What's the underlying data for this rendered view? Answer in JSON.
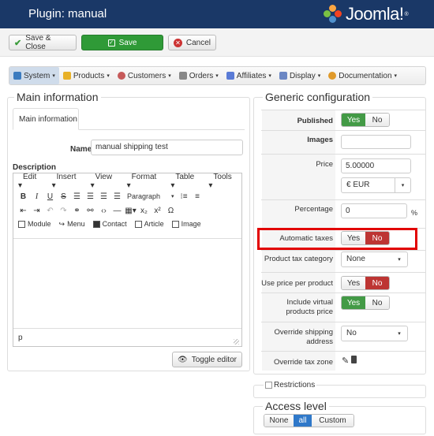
{
  "header": {
    "title": "Plugin: manual",
    "brand": "Joomla!",
    "brand_mark": "®"
  },
  "toolbar": {
    "save_close": "Save & Close",
    "save": "Save",
    "cancel": "Cancel"
  },
  "menu": {
    "items": [
      {
        "label": "System",
        "icon": "wrench-icon",
        "color": "#3b7bbf"
      },
      {
        "label": "Products",
        "icon": "box-icon",
        "color": "#e8b128"
      },
      {
        "label": "Customers",
        "icon": "users-icon",
        "color": "#c65a5a"
      },
      {
        "label": "Orders",
        "icon": "cart-icon",
        "color": "#888888"
      },
      {
        "label": "Affiliates",
        "icon": "chart-icon",
        "color": "#5a7bd6"
      },
      {
        "label": "Display",
        "icon": "monitor-icon",
        "color": "#6b87c4"
      },
      {
        "label": "Documentation",
        "icon": "help-icon",
        "color": "#e09a2a"
      }
    ]
  },
  "main": {
    "legend": "Main information",
    "tab": "Main information",
    "name_label": "Name",
    "name_value": "manual shipping test",
    "description_label": "Description",
    "editor": {
      "menus": [
        "Edit",
        "Insert",
        "View",
        "Format",
        "Table",
        "Tools"
      ],
      "paragraph": "Paragraph",
      "buttons": {
        "module": "Module",
        "menu": "Menu",
        "contact": "Contact",
        "article": "Article",
        "image": "Image"
      },
      "status": "p"
    },
    "toggle_editor": "Toggle editor"
  },
  "config": {
    "legend": "Generic configuration",
    "published_label": "Published",
    "images_label": "Images",
    "price_label": "Price",
    "price_value": "5.00000",
    "currency_value": "€ EUR",
    "percentage_label": "Percentage",
    "percentage_value": "0",
    "percent_sign": "%",
    "auto_taxes_label": "Automatic taxes",
    "tax_category_label": "Product tax category",
    "tax_category_value": "None",
    "use_price_label": "Use price per product",
    "include_virtual_label_1": "Include virtual",
    "include_virtual_label_2": "products price",
    "override_addr_label_1": "Override shipping",
    "override_addr_label_2": "address",
    "override_addr_value": "No",
    "override_zone_label": "Override tax zone",
    "yes": "Yes",
    "no": "No"
  },
  "restrictions": {
    "label": "Restrictions"
  },
  "access": {
    "legend": "Access level",
    "none": "None",
    "all": "all",
    "custom": "Custom"
  }
}
